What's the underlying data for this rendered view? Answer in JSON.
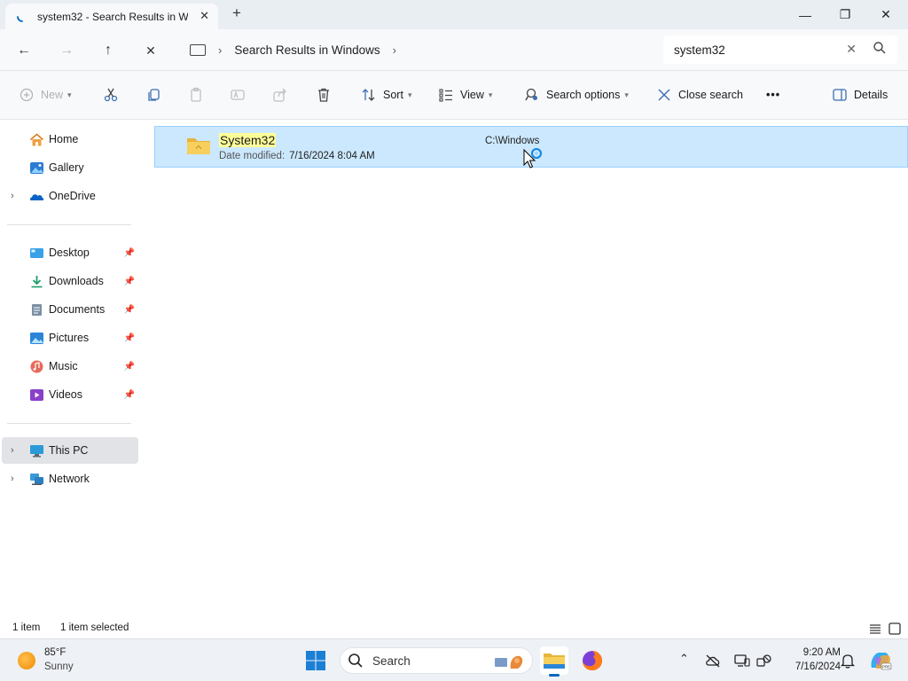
{
  "window": {
    "tab_title": "system32 - Search Results in W",
    "tab_close": "✕",
    "new_tab": "+",
    "minimize": "—",
    "maximize": "❐",
    "close": "✕"
  },
  "address": {
    "back": "←",
    "forward": "→",
    "up": "↑",
    "stop": "✕",
    "breadcrumb": "Search Results in Windows",
    "search_value": "system32",
    "clear": "✕"
  },
  "toolbar": {
    "new_label": "New",
    "sort_label": "Sort",
    "view_label": "View",
    "search_options_label": "Search options",
    "close_search_label": "Close search",
    "more_label": "•••",
    "details_label": "Details"
  },
  "sidebar": {
    "items": [
      {
        "label": "Home",
        "icon": "home-icon"
      },
      {
        "label": "Gallery",
        "icon": "gallery-icon"
      },
      {
        "label": "OneDrive",
        "icon": "onedrive-icon"
      },
      {
        "label": "Desktop",
        "icon": "desktop-icon",
        "pinned": true
      },
      {
        "label": "Downloads",
        "icon": "downloads-icon",
        "pinned": true
      },
      {
        "label": "Documents",
        "icon": "documents-icon",
        "pinned": true
      },
      {
        "label": "Pictures",
        "icon": "pictures-icon",
        "pinned": true
      },
      {
        "label": "Music",
        "icon": "music-icon",
        "pinned": true
      },
      {
        "label": "Videos",
        "icon": "videos-icon",
        "pinned": true
      },
      {
        "label": "This PC",
        "icon": "this-pc-icon",
        "selected": true
      },
      {
        "label": "Network",
        "icon": "network-icon"
      }
    ]
  },
  "results": {
    "items": [
      {
        "name": "System32",
        "date_label": "Date modified:",
        "date_value": "7/16/2024 8:04 AM",
        "location": "C:\\Windows"
      }
    ]
  },
  "status": {
    "count": "1 item",
    "selected": "1 item selected"
  },
  "taskbar": {
    "temp": "85°F",
    "condition": "Sunny",
    "search_label": "Search",
    "time": "9:20 AM",
    "date": "7/16/2024"
  },
  "colors": {
    "selection_bg": "#cce8ff",
    "selection_border": "#99d1ff",
    "accent": "#0067c0",
    "folder_yellow": "#f5c64a",
    "search_highlight": "#ffff99"
  }
}
